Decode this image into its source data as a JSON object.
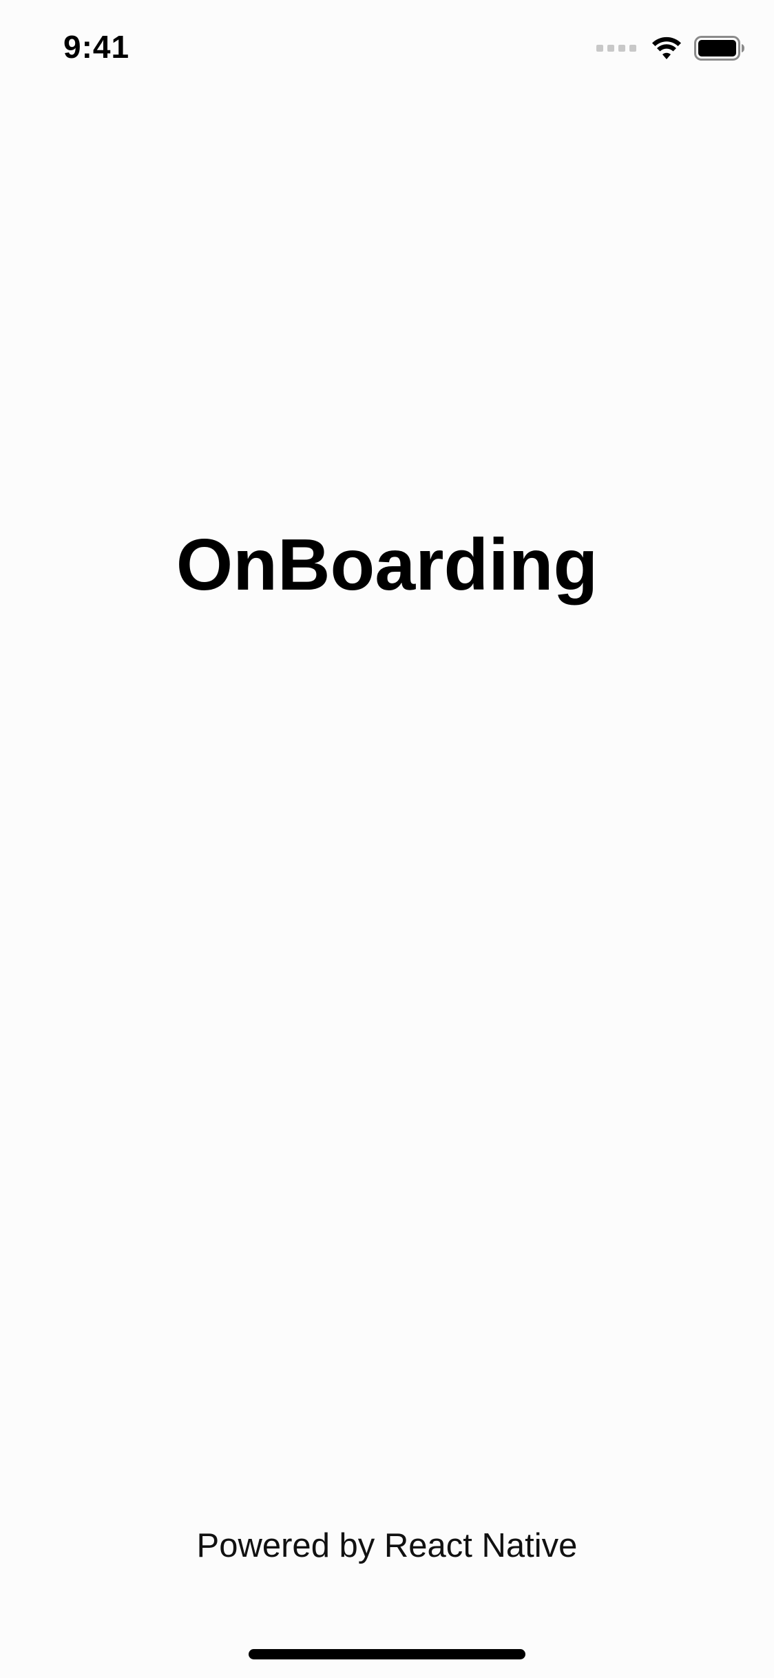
{
  "status_bar": {
    "time": "9:41",
    "icons": [
      "signal-icon",
      "wifi-icon",
      "battery-icon"
    ]
  },
  "main": {
    "title": "OnBoarding"
  },
  "footer": {
    "text": "Powered by React Native"
  },
  "colors": {
    "background": "#fcfcfc",
    "text": "#000000",
    "signal_inactive": "#c8c8c8"
  }
}
